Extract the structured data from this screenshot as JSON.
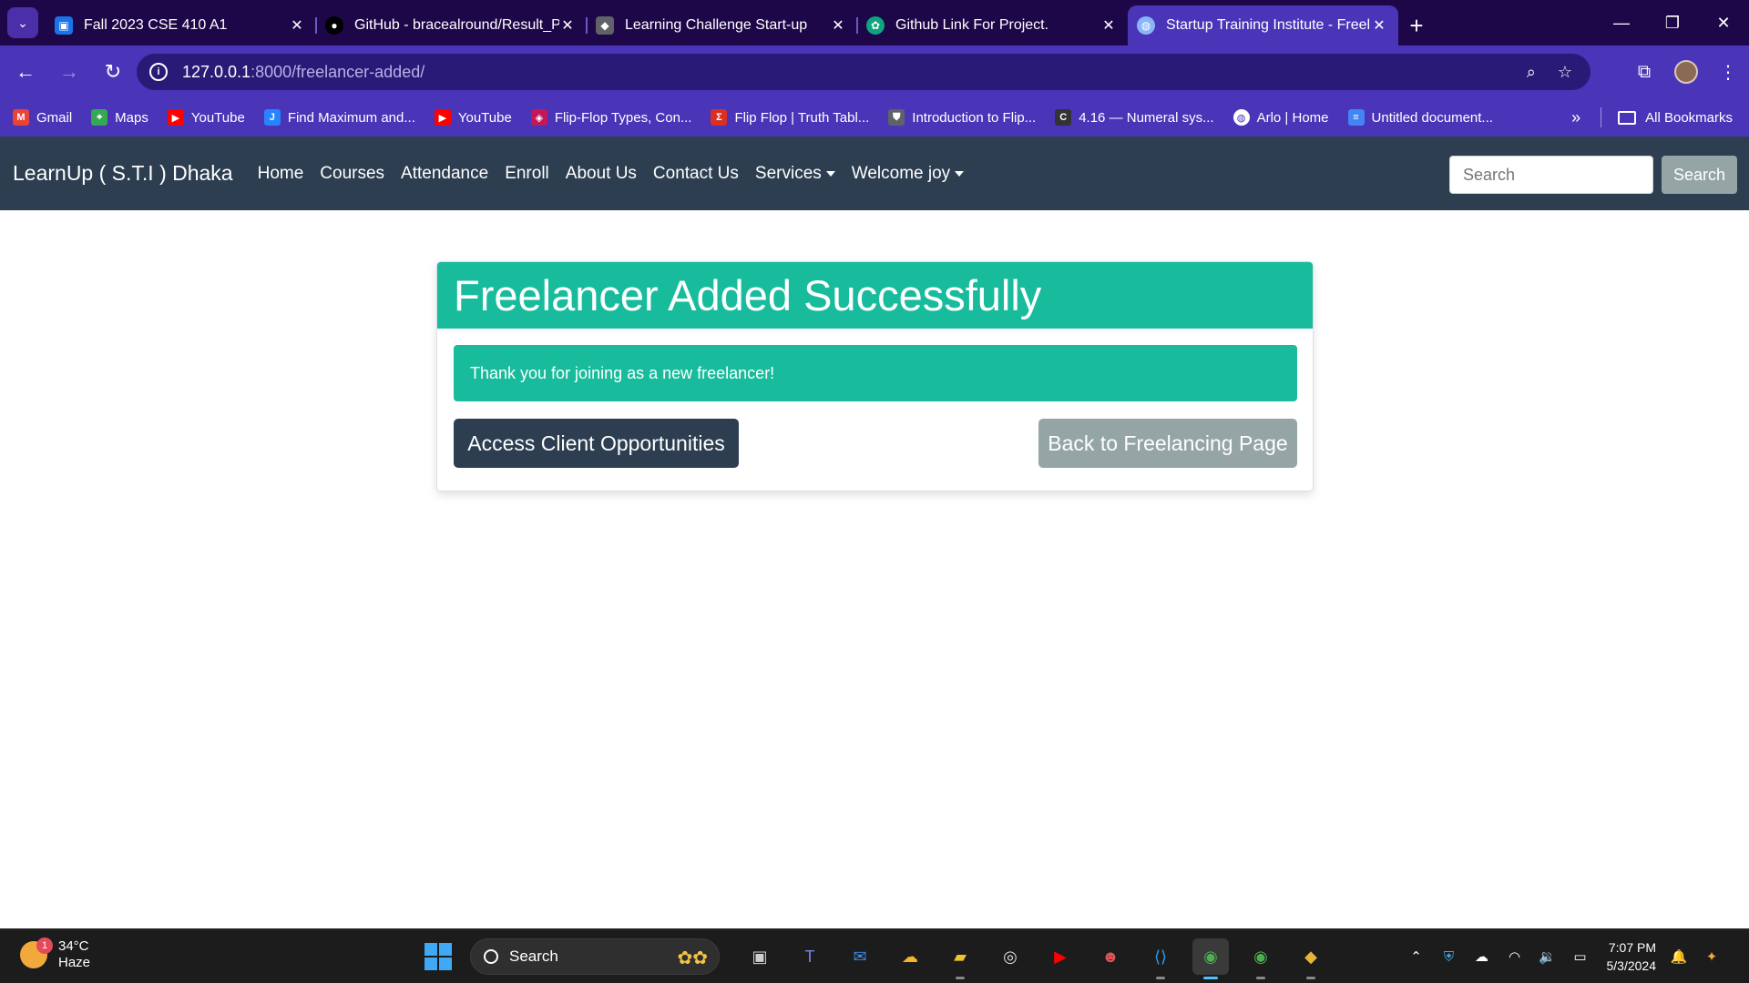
{
  "browser": {
    "tabs": [
      {
        "title": "Fall 2023 CSE 410 A1",
        "icon": "classroom-icon",
        "color": "#1a73e8"
      },
      {
        "title": "GitHub - bracealround/Result_P",
        "icon": "github-icon",
        "color": "#000000"
      },
      {
        "title": "Learning Challenge Start-up",
        "icon": "app-icon",
        "color": "#5f6368"
      },
      {
        "title": "Github Link For Project.",
        "icon": "chatgpt-icon",
        "color": "#10a37f"
      },
      {
        "title": "Startup Training Institute - Freel",
        "icon": "globe-icon",
        "color": "#8ab4f8",
        "active": true
      }
    ],
    "url_host": "127.0.0.1",
    "url_path": ":8000/freelancer-added/",
    "bookmarks": [
      {
        "label": "Gmail",
        "icon": "gmail-icon",
        "color": "#ea4335"
      },
      {
        "label": "Maps",
        "icon": "maps-icon",
        "color": "#34a853"
      },
      {
        "label": "YouTube",
        "icon": "youtube-icon",
        "color": "#ff0000"
      },
      {
        "label": "Find Maximum and...",
        "icon": "jira-icon",
        "color": "#2684ff"
      },
      {
        "label": "YouTube",
        "icon": "youtube-icon",
        "color": "#ff0000"
      },
      {
        "label": "Flip-Flop Types, Con...",
        "icon": "bookmark-icon",
        "color": "#c2185b"
      },
      {
        "label": "Flip Flop | Truth Tabl...",
        "icon": "sigma-icon",
        "color": "#d93025"
      },
      {
        "label": "Introduction to Flip...",
        "icon": "shield-icon",
        "color": "#5f6368"
      },
      {
        "label": "4.16 — Numeral sys...",
        "icon": "cpp-icon",
        "color": "#333333"
      },
      {
        "label": "Arlo | Home",
        "icon": "globe-icon",
        "color": "#ffffff"
      },
      {
        "label": "Untitled document...",
        "icon": "docs-icon",
        "color": "#4285f4"
      }
    ],
    "all_bookmarks": "All Bookmarks"
  },
  "site": {
    "brand": "LearnUp ( S.T.I ) Dhaka",
    "nav": [
      "Home",
      "Courses",
      "Attendance",
      "Enroll",
      "About Us",
      "Contact Us"
    ],
    "services": "Services",
    "welcome": "Welcome joy",
    "search_placeholder": "Search",
    "search_button": "Search"
  },
  "card": {
    "title": "Freelancer Added Successfully",
    "message": "Thank you for joining as a new freelancer!",
    "primary_button": "Access Client Opportunities",
    "secondary_button": "Back to Freelancing Page"
  },
  "taskbar": {
    "weather_temp": "34°C",
    "weather_cond": "Haze",
    "weather_badge": "1",
    "search_label": "Search",
    "time": "7:07 PM",
    "date": "5/3/2024"
  },
  "colors": {
    "tab_bar": "#1e0748",
    "browser_accent": "#4a35b8",
    "navbar": "#2c3e50",
    "success": "#18bc9c",
    "secondary": "#95a5a6"
  }
}
